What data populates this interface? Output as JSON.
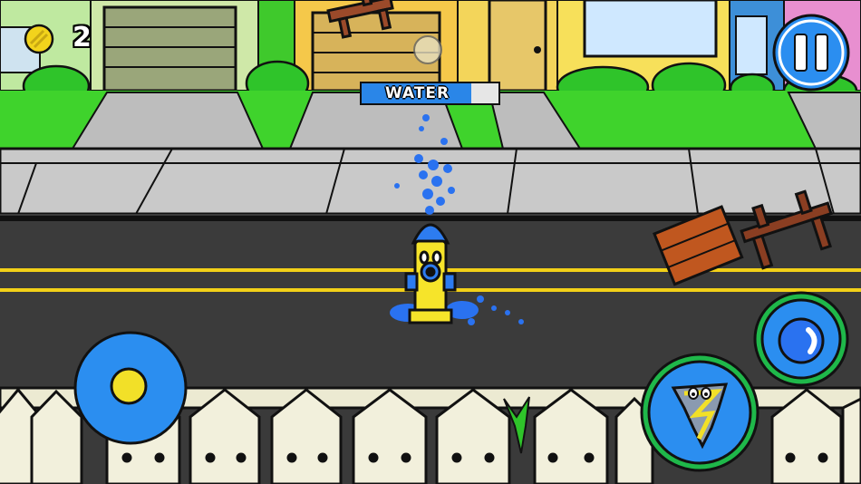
{
  "hud": {
    "coins": "2",
    "water_label": "WATER",
    "water_level": 0.8
  },
  "icons": {
    "coin": "coin-icon",
    "pause": "pause-icon",
    "joystick": "joystick-thumb-icon",
    "splash": "water-drop-icon",
    "tornado": "tornado-icon"
  },
  "colors": {
    "sky_house_yellow": "#f5d64e",
    "grass": "#3fd32c",
    "sidewalk": "#c9c9c9",
    "road": "#3b3b3b",
    "road_line": "#f2d018",
    "fence": "#f2f0dc",
    "button_blue": "#2b8ef0",
    "button_ring": "#1fb84a",
    "water_fill": "#2a86e8",
    "hydrant_yellow": "#f6e42a",
    "hydrant_blue": "#2d7cf0"
  }
}
